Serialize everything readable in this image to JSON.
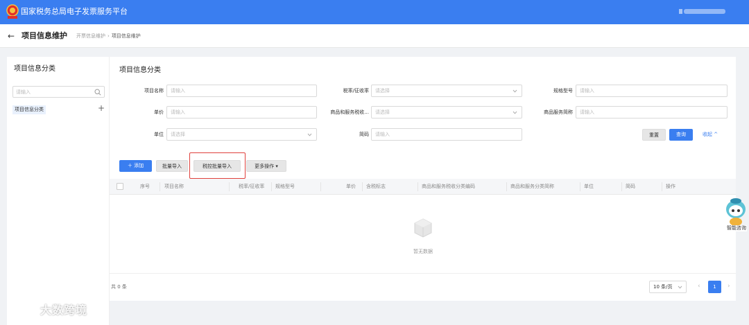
{
  "topbar": {
    "site_title": "国家税务总局电子发票服务平台",
    "accent": "#3a7ef0"
  },
  "header": {
    "back_icon": "arrow-left-icon",
    "title": "项目信息维护",
    "breadcrumb": [
      "开票信息维护",
      "项目信息维护"
    ]
  },
  "sidebar": {
    "title": "项目信息分类",
    "search_placeholder": "请输入",
    "tree": [
      {
        "label": "项目信息分类"
      }
    ]
  },
  "main": {
    "title": "项目信息分类",
    "filters": {
      "project_name": {
        "label": "项目名称",
        "placeholder": "请输入"
      },
      "tax_rate": {
        "label": "税率/征收率",
        "placeholder": "请选择"
      },
      "spec_model": {
        "label": "规格型号",
        "placeholder": "请输入"
      },
      "unit_price": {
        "label": "单价",
        "placeholder": "请输入"
      },
      "tax_category": {
        "label": "商品和服务税收...",
        "placeholder": "请选择"
      },
      "short_name": {
        "label": "商品服务简称",
        "placeholder": "请输入"
      },
      "unit": {
        "label": "单位",
        "placeholder": "请选择"
      },
      "short_code": {
        "label": "简码",
        "placeholder": "请输入"
      }
    },
    "buttons": {
      "reset": "重置",
      "query": "查询",
      "collapse": "收起"
    },
    "toolbar": {
      "add": "添加",
      "batch_import": "批量导入",
      "tax_control_import": "税控批量导入",
      "more": "更多操作"
    },
    "table": {
      "columns": [
        "序号",
        "项目名称",
        "税率/征收率",
        "规格型号",
        "单价",
        "含税标志",
        "商品和服务税收分类编码",
        "商品和服务分类简称",
        "单位",
        "简码",
        "操作"
      ],
      "empty_text": "暂无数据"
    }
  },
  "pagination": {
    "total": "共 0 条",
    "page_size": "10 条/页",
    "current_page": "1"
  },
  "assistant": {
    "label": "智能咨询"
  },
  "watermark": {
    "text": "大数跨境"
  }
}
